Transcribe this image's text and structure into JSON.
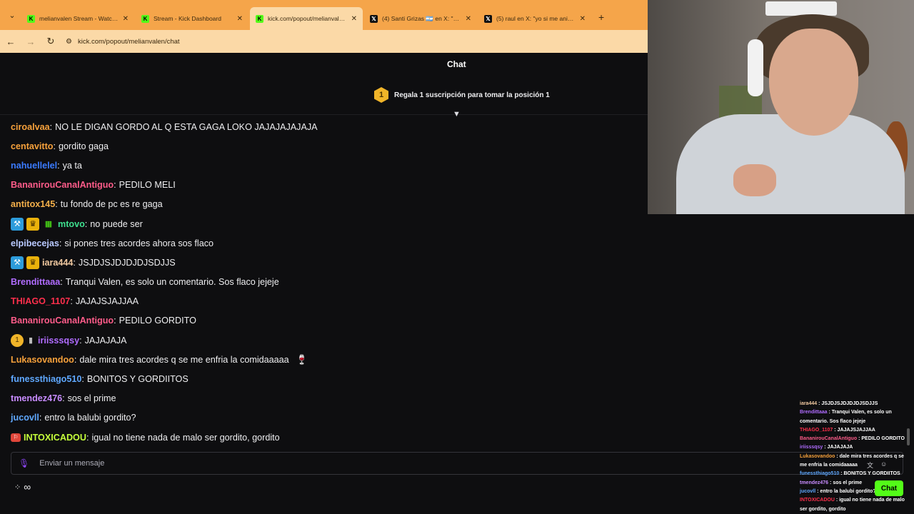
{
  "browser": {
    "tabs": [
      {
        "icon": "kick",
        "title": "melianvalen Stream - Watch Li...",
        "active": false
      },
      {
        "icon": "kick",
        "title": "Stream - Kick Dashboard",
        "active": false
      },
      {
        "icon": "kick",
        "title": "kick.com/popout/melianvalen/...",
        "active": true
      },
      {
        "icon": "x",
        "title": "(4) Santi Grizas 🇦🇷 en X: \"S...",
        "active": false
      },
      {
        "icon": "x",
        "title": "(5) raul en X: \"yo si me animo h...",
        "active": false
      }
    ],
    "new_tab": "+",
    "url": "kick.com/popout/melianvalen/chat"
  },
  "chat": {
    "header": "Chat",
    "pinned": {
      "badge": "1",
      "text": "Regala 1 suscripción para tomar la posición 1"
    },
    "messages": [
      {
        "user": "ciroalvaa",
        "color": "#f7a13b",
        "badges": [],
        "text": "NO LE DIGAN GORDO AL Q ESTA GAGA LOKO JAJAJAJAJAJA"
      },
      {
        "user": "centavitto",
        "color": "#f7a13b",
        "badges": [],
        "text": "gordito gaga"
      },
      {
        "user": "nahuellelel",
        "color": "#3b7bff",
        "badges": [],
        "text": "ya ta"
      },
      {
        "user": "BananirouCanalAntiguo",
        "color": "#ff5c8a",
        "badges": [],
        "text": "PEDILO MELI"
      },
      {
        "user": "antitox145",
        "color": "#f5b04a",
        "badges": [],
        "text": "tu fondo de pc es re gaga"
      },
      {
        "user": "mtovo",
        "color": "#3ee08f",
        "badges": [
          "mod",
          "vip",
          "gift"
        ],
        "text": "no puede ser"
      },
      {
        "user": "elpibecejas",
        "color": "#b9c9ff",
        "badges": [],
        "text": "si pones tres acordes ahora sos flaco"
      },
      {
        "user": "iara444",
        "color": "#f1c9a0",
        "badges": [
          "mod",
          "vip"
        ],
        "text": "JSJDJSJDJDJDJSDJJS"
      },
      {
        "user": "Brendittaaa",
        "color": "#b06cff",
        "badges": [],
        "text": "Tranqui Valen, es solo un comentario. Sos flaco jejeje"
      },
      {
        "user": "THIAGO_1107",
        "color": "#ff2f4c",
        "badges": [],
        "text": "JAJAJSJAJJAA"
      },
      {
        "user": "BananirouCanalAntiguo",
        "color": "#ff5c8a",
        "badges": [],
        "text": "PEDILO GORDITO"
      },
      {
        "user": "iriisssqsy",
        "color": "#b06cff",
        "badges": [
          "sub1",
          "bottle"
        ],
        "text": "JAJAJAJA"
      },
      {
        "user": "Lukasovandoo",
        "color": "#f7a13b",
        "badges": [],
        "text": "dale mira tres acordes q se me enfria la comidaaaaa",
        "emote": "🍷"
      },
      {
        "user": "funessthiago510",
        "color": "#5fa8ff",
        "badges": [],
        "text": "BONITOS Y GORDIITOS"
      },
      {
        "user": "tmendez476",
        "color": "#c88cff",
        "badges": [],
        "text": "sos el prime"
      },
      {
        "user": "jucovll",
        "color": "#5fa8ff",
        "badges": [],
        "text": "entro la balubi gordito?"
      },
      {
        "user": "INTOXICADOU",
        "color": "#c6ff3b",
        "badges": [
          "tag"
        ],
        "text": "igual no tiene nada de malo ser gordito, gordito"
      }
    ],
    "input_placeholder": "Enviar un mensaje",
    "bottom_icons": [
      "dots-icon",
      "infinity-icon"
    ],
    "bottom_symbol": "∞"
  },
  "overlay": {
    "lines": [
      {
        "user": "iara444",
        "color": "#f1c9a0",
        "text": "JSJDJSJDJDJDJSDJJS"
      },
      {
        "user": "Brendittaaa",
        "color": "#b06cff",
        "text": "Tranqui Valen, es solo un comentario. Sos flaco jejeje"
      },
      {
        "user": "THIAGO_1107",
        "color": "#ff2f4c",
        "text": "JAJAJSJAJJAA"
      },
      {
        "user": "BananirouCanalAntiguo",
        "color": "#ff5c8a",
        "text": "PEDILO GORDITO"
      },
      {
        "user": "iriisssqsy",
        "color": "#b06cff",
        "text": "JAJAJAJA"
      },
      {
        "user": "Lukasovandoo",
        "color": "#f7a13b",
        "text": "dale mira tres acordes q se me enfria la comidaaaaa"
      },
      {
        "user": "funessthiago510",
        "color": "#5fa8ff",
        "text": "BONITOS Y GORDIITOS"
      },
      {
        "user": "tmendez476",
        "color": "#c88cff",
        "text": "sos el prime"
      },
      {
        "user": "jucovll",
        "color": "#5fa8ff",
        "text": "entro la balubi gordito?"
      },
      {
        "user": "INTOXICADOU",
        "color": "#ff2f4c",
        "text": "igual no tiene nada de malo ser gordito, gordito"
      }
    ],
    "chat_button": "Chat"
  }
}
